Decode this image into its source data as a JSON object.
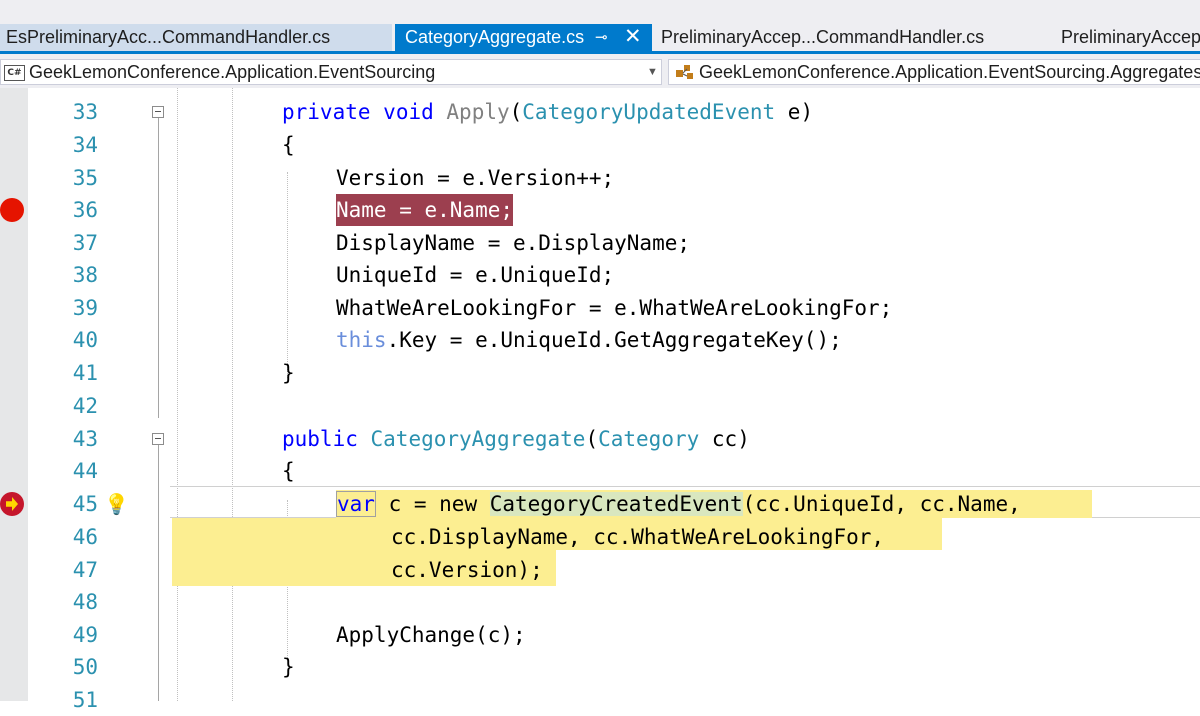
{
  "tabs": [
    {
      "label": "EsPreliminaryAcc...CommandHandler.cs",
      "active": false
    },
    {
      "label": "CategoryAggregate.cs",
      "active": true,
      "pin": "⊸",
      "close": "✕"
    },
    {
      "label": "PreliminaryAccep...CommandHandler.cs",
      "active": false
    },
    {
      "label": "PreliminaryAccep",
      "active": false
    }
  ],
  "navbar": {
    "project_icon": "C#",
    "project": "GeekLemonConference.Application.EventSourcing",
    "dropdown_glyph": "▼",
    "type": "GeekLemonConference.Application.EventSourcing.Aggregates.C"
  },
  "lines": [
    {
      "n": "33",
      "text": "private void Apply(CategoryUpdatedEvent e)"
    },
    {
      "n": "34",
      "text": "{"
    },
    {
      "n": "35",
      "text": "    Version = e.Version++;"
    },
    {
      "n": "36",
      "text": "    Name = e.Name;"
    },
    {
      "n": "37",
      "text": "    DisplayName = e.DisplayName;"
    },
    {
      "n": "38",
      "text": "    UniqueId = e.UniqueId;"
    },
    {
      "n": "39",
      "text": "    WhatWeAreLookingFor = e.WhatWeAreLookingFor;"
    },
    {
      "n": "40",
      "text": "    this.Key = e.UniqueId.GetAggregateKey();"
    },
    {
      "n": "41",
      "text": "}"
    },
    {
      "n": "42",
      "text": ""
    },
    {
      "n": "43",
      "text": "public CategoryAggregate(Category cc)"
    },
    {
      "n": "44",
      "text": "{"
    },
    {
      "n": "45",
      "text": "    var c = new CategoryCreatedEvent(cc.UniqueId, cc.Name,"
    },
    {
      "n": "46",
      "text": "        cc.DisplayName, cc.WhatWeAreLookingFor,"
    },
    {
      "n": "47",
      "text": "        cc.Version);"
    },
    {
      "n": "48",
      "text": ""
    },
    {
      "n": "49",
      "text": "    ApplyChange(c);"
    },
    {
      "n": "50",
      "text": "}"
    },
    {
      "n": "51",
      "text": ""
    }
  ],
  "code_tokens": {
    "l33": [
      "private",
      " ",
      "void",
      " ",
      "Apply",
      "(",
      "CategoryUpdatedEvent",
      " e)"
    ],
    "l35": "Version = e.Version++;",
    "l36": "Name = e.Name;",
    "l37": "DisplayName = e.DisplayName;",
    "l38": "UniqueId = e.UniqueId;",
    "l39": "WhatWeAreLookingFor = e.WhatWeAreLookingFor;",
    "l40_this": "this",
    "l40_rest": ".Key = e.UniqueId.GetAggregateKey();",
    "l43": [
      "public",
      " ",
      "CategoryAggregate",
      "(",
      "Category",
      " cc)"
    ],
    "l45_var": "var",
    "l45_mid": " c = new ",
    "l45_type": "CategoryCreatedEvent",
    "l45_rest": "(cc.UniqueId, cc.Name,",
    "l46": "cc.DisplayName, cc.WhatWeAreLookingFor,",
    "l47": "cc.Version);",
    "l49": "ApplyChange(c);",
    "brace_open": "{",
    "brace_close": "}"
  },
  "colors": {
    "keyword": "#0000ff",
    "type": "#2b91af",
    "breakpoint_highlight": "#9c3f4f",
    "current_statement": "#fcee91",
    "accent": "#007acc"
  },
  "icons": {
    "breakpoint": "breakpoint-icon",
    "current_statement": "current-statement-arrow-icon",
    "lightbulb": "lightbulb-icon",
    "bulb_glyph": "💡"
  }
}
